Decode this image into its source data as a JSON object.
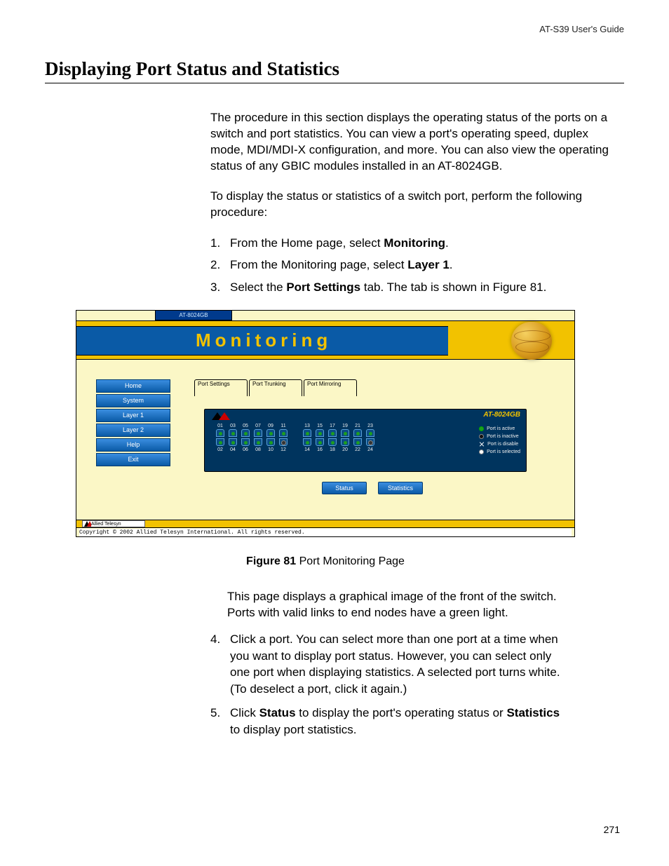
{
  "running_head": "AT-S39 User's Guide",
  "section_title": "Displaying Port Status and Statistics",
  "intro_para": "The procedure in this section displays the operating status of the ports on a switch and port statistics. You can view a port's operating speed, duplex mode, MDI/MDI-X configuration, and more. You can also view the operating status of any GBIC modules installed in an AT-8024GB.",
  "lead_in": "To display the status or statistics of a switch port, perform the following procedure:",
  "steps_top": {
    "s1_pre": "From the Home page, select ",
    "s1_bold": "Monitoring",
    "s1_post": ".",
    "s2_pre": "From the Monitoring page, select ",
    "s2_bold": "Layer 1",
    "s2_post": ".",
    "s3_pre": "Select the ",
    "s3_bold": "Port Settings",
    "s3_post": " tab. The tab is shown in Figure 81."
  },
  "figure": {
    "model_tab": "AT-8024GB",
    "page_title": "Monitoring",
    "nav": [
      "Home",
      "System",
      "Layer 1",
      "Layer 2",
      "Help",
      "Exit"
    ],
    "tabs": [
      "Port Settings",
      "Port Trunking",
      "Port Mirroring"
    ],
    "switch_model": "AT-8024GB",
    "ports_top": [
      "01",
      "03",
      "05",
      "07",
      "09",
      "11",
      "13",
      "15",
      "17",
      "19",
      "21",
      "23"
    ],
    "ports_bottom": [
      "02",
      "04",
      "06",
      "08",
      "10",
      "12",
      "14",
      "16",
      "18",
      "20",
      "22",
      "24"
    ],
    "legend": {
      "active": "Port is active",
      "inactive": "Port is inactive",
      "disable": "Port is disable",
      "selected": "Port is selected"
    },
    "buttons": {
      "status": "Status",
      "statistics": "Statistics"
    },
    "logo_text": "Allied Telesyn",
    "copyright": "Copyright © 2002 Allied Telesyn International. All rights reserved."
  },
  "figure_caption": {
    "label": "Figure 81",
    "text": "  Port Monitoring Page"
  },
  "after_fig_para": "This page displays a graphical image of the front of the switch. Ports with valid links to end nodes have a green light.",
  "steps_bottom": {
    "s4_num": "4.",
    "s4_text": "Click a port. You can select more than one port at a time when you want to display port status. However, you can select only one port when displaying statistics. A selected port turns white. (To deselect a port, click it again.)",
    "s5_num": "5.",
    "s5_pre": "Click ",
    "s5_b1": "Status",
    "s5_mid": " to display the port's operating status or ",
    "s5_b2": "Statistics",
    "s5_post": " to display port statistics."
  },
  "page_number": "271"
}
